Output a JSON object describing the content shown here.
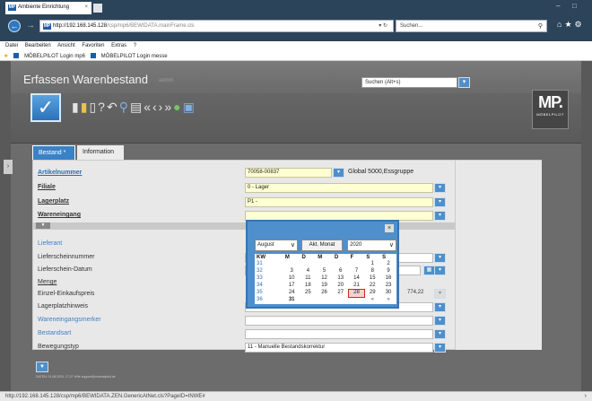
{
  "browser": {
    "url_host": "http://192.168.145.128",
    "url_rest": "/csp/mp6/BEWIDATA.mainFrame.cls",
    "search_placeholder": "Suchen...",
    "tab_title": "Ambiente Einrichtung",
    "menu": [
      "Datei",
      "Bearbeiten",
      "Ansicht",
      "Favoriten",
      "Extras",
      "?"
    ],
    "favorites": [
      "MÖBELPILOT Login mp6",
      "MÖBELPILOT Login messe"
    ],
    "status_url": "http://192.168.145.128/csp/mp6/BEWIDATA.ZEN.GenericAtNet.cls?PageID=INWE#"
  },
  "app": {
    "title": "Erfassen Warenbestand",
    "user": "admin",
    "search_placeholder": "Suchen (Alt+s)",
    "logo": {
      "main": "MP.",
      "sub": "MÖBELPILOT"
    },
    "tabs": [
      "Bestand *",
      "Information"
    ]
  },
  "form": {
    "artikelnummer": {
      "label": "Artikelnummer",
      "value": "70058-00837",
      "desc": "Global 5000,Essgruppe"
    },
    "filiale": {
      "label": "Filiale",
      "value": "0 - Lager"
    },
    "lagerplatz": {
      "label": "Lagerplatz",
      "value": "P1 -"
    },
    "wareneingang": {
      "label": "Wareneingang"
    },
    "lieferant": {
      "label": "Lieferant"
    },
    "lieferscheinnummer": {
      "label": "Lieferscheinnummer"
    },
    "lieferschein_datum": {
      "label": "Lieferschein-Datum"
    },
    "menge": {
      "label": "Menge"
    },
    "einzel_einkaufspreis": {
      "label": "Einzel-Einkaufspreis",
      "value": "774,22"
    },
    "lagerplatzhinweis": {
      "label": "Lagerplatzhinweis"
    },
    "wareneingangsmerker": {
      "label": "Wareneingangsmerker"
    },
    "bestandsart": {
      "label": "Bestandsart"
    },
    "bewegungstyp": {
      "label": "Bewegungstyp",
      "value": "11 - Manuelle Bestandskorrektur"
    }
  },
  "calendar": {
    "month": "August",
    "akt_monat": "Akt. Monat",
    "year": "2020",
    "headers": [
      "KW",
      "M",
      "D",
      "M",
      "D",
      "F",
      "S",
      "S"
    ],
    "weeks": [
      [
        "31",
        "",
        "",
        "",
        "",
        "",
        "1",
        "2"
      ],
      [
        "32",
        "3",
        "4",
        "5",
        "6",
        "7",
        "8",
        "9"
      ],
      [
        "33",
        "10",
        "11",
        "12",
        "13",
        "14",
        "15",
        "16"
      ],
      [
        "34",
        "17",
        "18",
        "19",
        "20",
        "21",
        "22",
        "23"
      ],
      [
        "35",
        "24",
        "25",
        "26",
        "27",
        "28",
        "29",
        "30"
      ],
      [
        "36",
        "31",
        "",
        "",
        "",
        "",
        "«",
        "»"
      ]
    ],
    "today": "28"
  },
  "footer": {
    "text": "DATEN: 31.08.2020, 17:27 Hilfe support@moebelpilot.de"
  },
  "colors": {
    "accent": "#4e8fcc",
    "field_yellow": "#ffffd4",
    "link_blue": "#2b6fb5"
  }
}
